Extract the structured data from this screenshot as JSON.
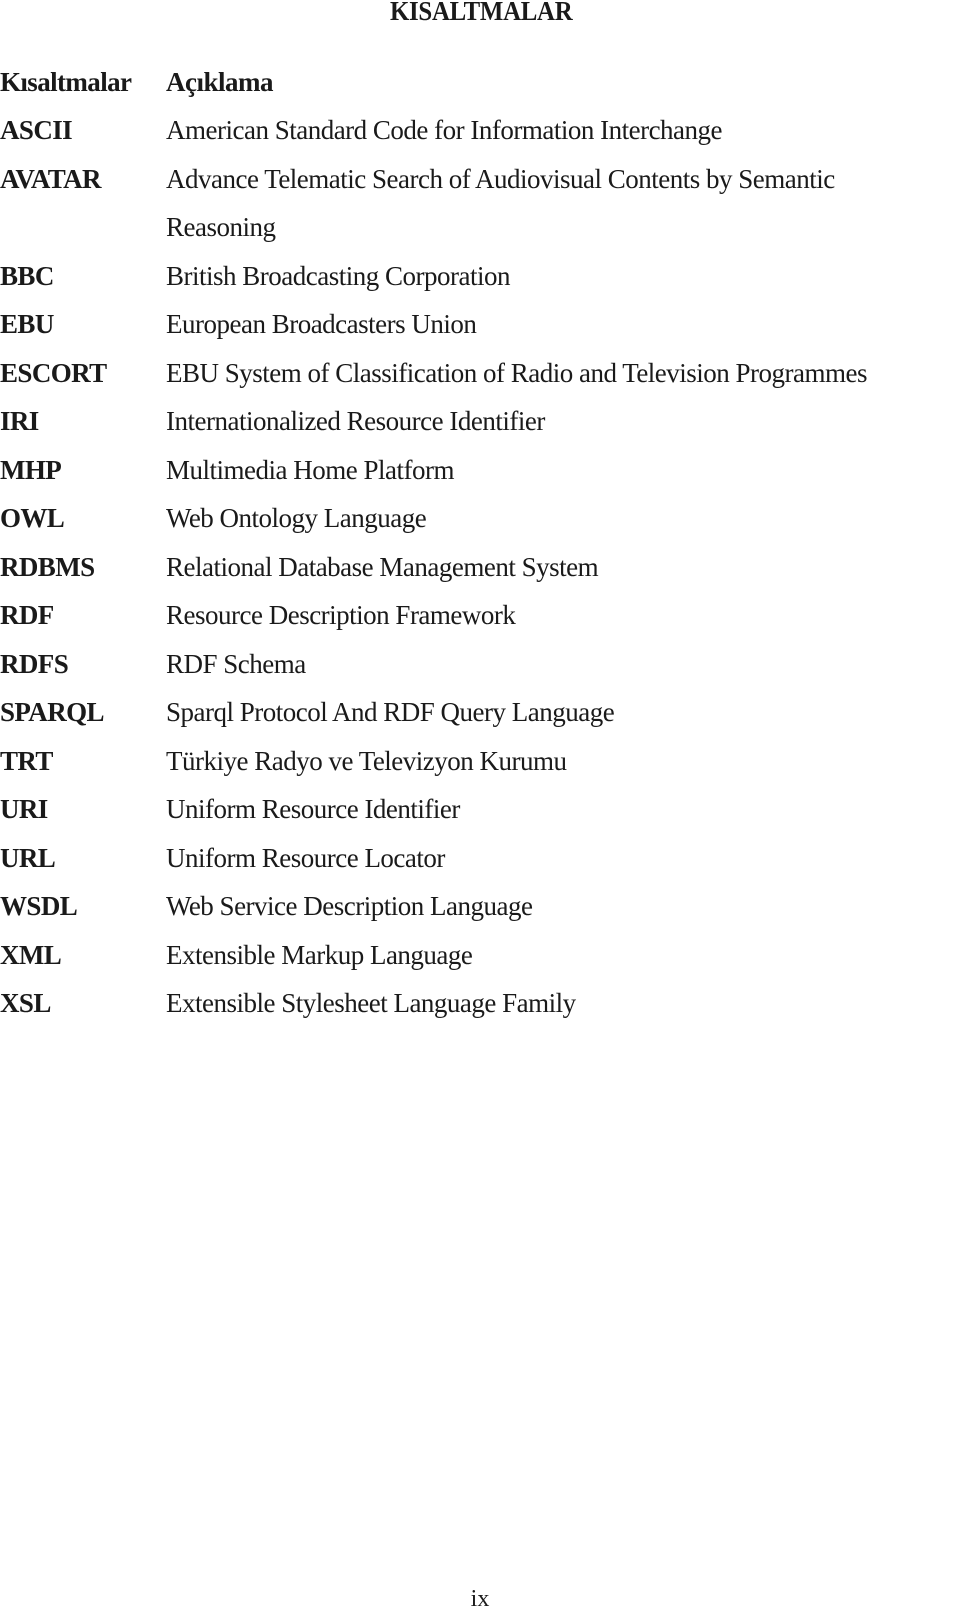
{
  "page_title": "KISALTMALAR",
  "table": {
    "headers": {
      "abbr": "Kısaltmalar",
      "desc": "Açıklama"
    },
    "rows": [
      {
        "abbr": "ASCII",
        "desc": "American Standard Code for Information Interchange"
      },
      {
        "abbr": "AVATAR",
        "desc": "Advance Telematic Search of Audiovisual Contents by Semantic",
        "desc_cont": "Reasoning"
      },
      {
        "abbr": "BBC",
        "desc": "British Broadcasting Corporation"
      },
      {
        "abbr": "EBU",
        "desc": "European Broadcasters Union"
      },
      {
        "abbr": "ESCORT",
        "desc": "EBU System of Classification of Radio and Television Programmes"
      },
      {
        "abbr": "IRI",
        "desc": "Internationalized Resource Identifier"
      },
      {
        "abbr": "MHP",
        "desc": "Multimedia Home Platform"
      },
      {
        "abbr": "OWL",
        "desc": "Web Ontology Language"
      },
      {
        "abbr": "RDBMS",
        "desc": "Relational Database Management System"
      },
      {
        "abbr": "RDF",
        "desc": "Resource Description Framework"
      },
      {
        "abbr": "RDFS",
        "desc": "RDF Schema"
      },
      {
        "abbr": "SPARQL",
        "desc": "Sparql Protocol And RDF Query Language"
      },
      {
        "abbr": "TRT",
        "desc": "Türkiye Radyo ve Televizyon Kurumu"
      },
      {
        "abbr": "URI",
        "desc": "Uniform Resource Identifier"
      },
      {
        "abbr": "URL",
        "desc": "Uniform Resource Locator"
      },
      {
        "abbr": "WSDL",
        "desc": "Web Service Description Language"
      },
      {
        "abbr": "XML",
        "desc": "Extensible Markup Language"
      },
      {
        "abbr": "XSL",
        "desc": "Extensible Stylesheet Language Family"
      }
    ]
  },
  "page_number": "ix"
}
